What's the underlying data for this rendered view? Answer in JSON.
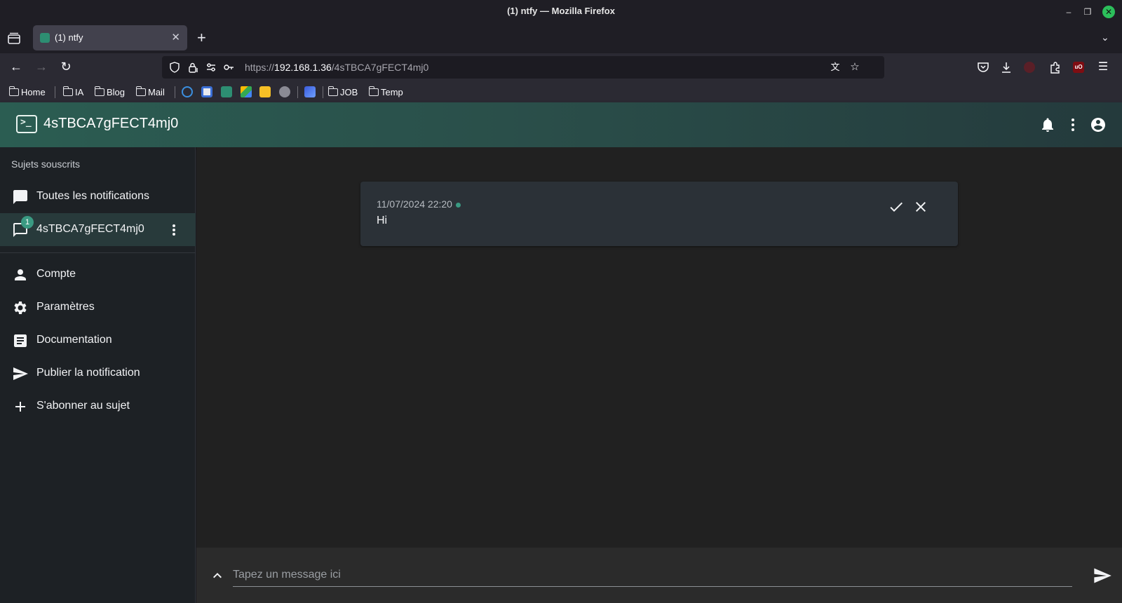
{
  "window": {
    "title": "(1) ntfy — Mozilla Firefox"
  },
  "browser": {
    "tab": {
      "title": "(1) ntfy"
    },
    "url": {
      "scheme": "https://",
      "host": "192.168.1.36",
      "path": "/4sTBCA7gFECT4mj0"
    },
    "bookmarks": [
      {
        "label": "Home",
        "type": "folder"
      },
      {
        "label": "IA",
        "type": "folder"
      },
      {
        "label": "Blog",
        "type": "folder"
      },
      {
        "label": "Mail",
        "type": "folder"
      },
      {
        "label": "JOB",
        "type": "folder"
      },
      {
        "label": "Temp",
        "type": "folder"
      }
    ]
  },
  "app": {
    "title": "4sTBCA7gFECT4mj0",
    "accent": "#3a9a82"
  },
  "sidebar": {
    "header": "Sujets souscrits",
    "items": [
      {
        "label": "Toutes les notifications",
        "icon": "chat-icon"
      },
      {
        "label": "4sTBCA7gFECT4mj0",
        "icon": "chat-outline-icon",
        "badge": "1",
        "selected": true
      },
      {
        "label": "Compte",
        "icon": "person-icon"
      },
      {
        "label": "Paramètres",
        "icon": "gear-icon"
      },
      {
        "label": "Documentation",
        "icon": "article-icon"
      },
      {
        "label": "Publier la notification",
        "icon": "send-icon"
      },
      {
        "label": "S'abonner au sujet",
        "icon": "plus-icon"
      }
    ]
  },
  "notifications": [
    {
      "time": "11/07/2024 22:20",
      "message": "Hi",
      "unread": true
    }
  ],
  "composer": {
    "placeholder": "Tapez un message ici"
  }
}
